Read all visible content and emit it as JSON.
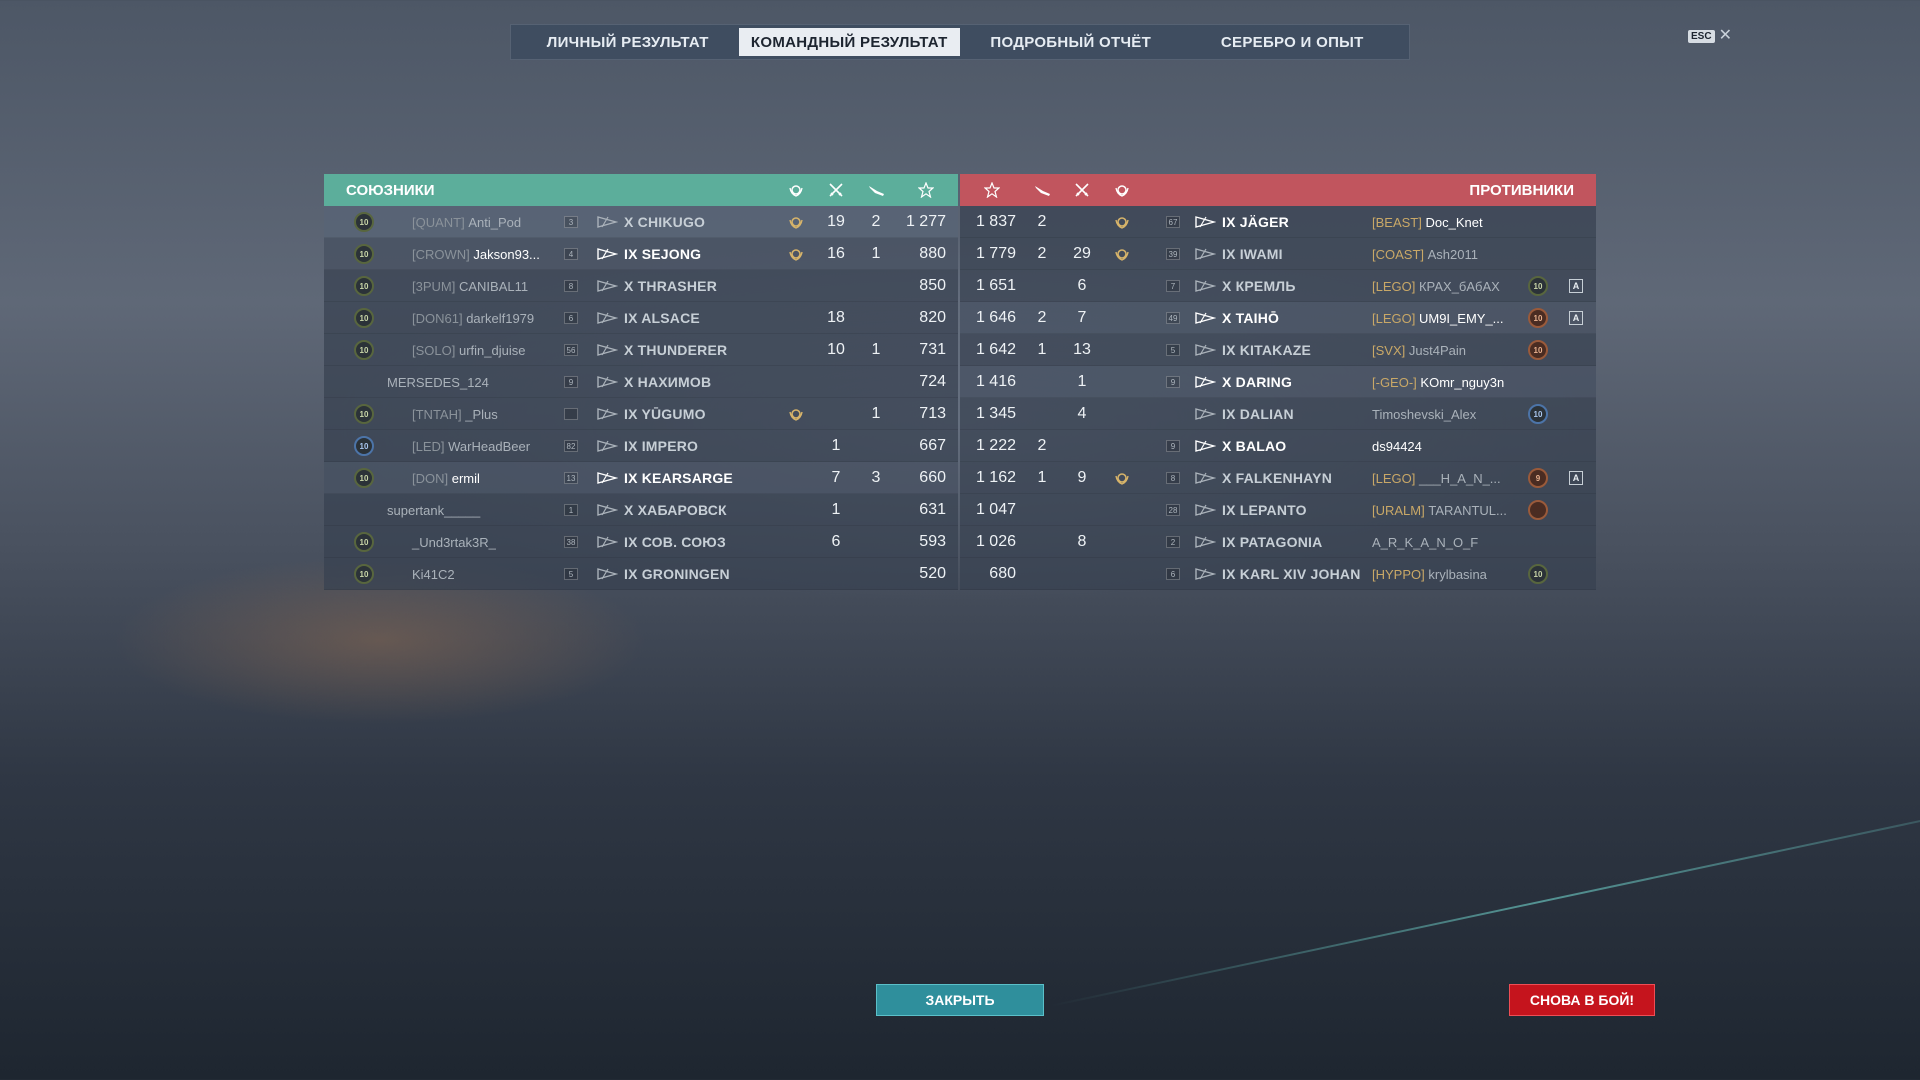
{
  "tabs": [
    {
      "label": "ЛИЧНЫЙ РЕЗУЛЬТАТ",
      "active": false
    },
    {
      "label": "КОМАНДНЫЙ РЕЗУЛЬТАТ",
      "active": true
    },
    {
      "label": "ПОДРОБНЫЙ ОТЧЁТ",
      "active": false
    },
    {
      "label": "СЕРЕБРО И ОПЫТ",
      "active": false
    }
  ],
  "esc_label": "ESC",
  "allies": {
    "title": "СОЮЗНИКИ",
    "accent": "#5cae9b",
    "rows": [
      {
        "level": "10",
        "clan": "[QUANT]",
        "player": "Anti_Pod",
        "rank": "3",
        "ship": "X CHIKUGO",
        "medal": true,
        "kills": "19",
        "planes": "2",
        "xp": "1 277",
        "highlight": "hl"
      },
      {
        "level": "10",
        "clan": "[CROWN]",
        "player": "Jakson93...",
        "rank": "4",
        "ship": "IX SEJONG",
        "medal": true,
        "kills": "16",
        "planes": "1",
        "xp": "880",
        "highlight": "hl2",
        "bright": true
      },
      {
        "level": "10",
        "clan": "[3PUM]",
        "player": "CANIBAL11",
        "rank": "8",
        "ship": "X THRASHER",
        "medal": false,
        "kills": "",
        "planes": "",
        "xp": "850",
        "highlight": ""
      },
      {
        "level": "10",
        "clan": "[DON61]",
        "player": "darkelf1979",
        "rank": "6",
        "ship": "IX ALSACE",
        "medal": false,
        "kills": "18",
        "planes": "",
        "xp": "820",
        "highlight": ""
      },
      {
        "level": "10",
        "clan": "[SOLO]",
        "player": "urfin_djuise",
        "rank": "56",
        "ship": "X THUNDERER",
        "medal": false,
        "kills": "10",
        "planes": "1",
        "xp": "731",
        "highlight": ""
      },
      {
        "level": "",
        "clan": "",
        "player": "MERSEDES_124",
        "rank": "9",
        "ship": "X НАХИМОВ",
        "medal": false,
        "kills": "",
        "planes": "",
        "xp": "724",
        "highlight": ""
      },
      {
        "level": "10",
        "clan": "[TNTAH]",
        "player": "_Plus",
        "rank": "",
        "ship": "IX YŪGUMO",
        "medal": true,
        "kills": "",
        "planes": "1",
        "xp": "713",
        "highlight": ""
      },
      {
        "level": "10",
        "clan": "[LED]",
        "player": "WarHeadBeer",
        "rank": "82",
        "ship": "IX IMPERO",
        "medal": false,
        "kills": "1",
        "planes": "",
        "xp": "667",
        "highlight": "",
        "blue": true
      },
      {
        "level": "10",
        "clan": "[DON]",
        "player": "ermil",
        "rank": "13",
        "ship": "IX KEARSARGE",
        "medal": false,
        "kills": "7",
        "planes": "3",
        "xp": "660",
        "highlight": "hl2",
        "bright": true
      },
      {
        "level": "",
        "clan": "",
        "player": "supertank_____",
        "rank": "1",
        "ship": "X ХАБАРОВСК",
        "medal": false,
        "kills": "1",
        "planes": "",
        "xp": "631",
        "highlight": ""
      },
      {
        "level": "10",
        "clan": "",
        "player": "_Und3rtak3R_",
        "rank": "38",
        "ship": "IX СОВ. СОЮЗ",
        "medal": false,
        "kills": "6",
        "planes": "",
        "xp": "593",
        "highlight": ""
      },
      {
        "level": "10",
        "clan": "",
        "player": "Ki41C2",
        "rank": "5",
        "ship": "IX GRONINGEN",
        "medal": false,
        "kills": "",
        "planes": "",
        "xp": "520",
        "highlight": ""
      }
    ]
  },
  "enemies": {
    "title": "ПРОТИВНИКИ",
    "accent": "#c1555e",
    "rows": [
      {
        "xp": "1 837",
        "planes": "2",
        "kills": "",
        "medal": true,
        "rank": "67",
        "ship": "IX JÄGER",
        "clan": "[BEAST]",
        "player": "Doc_Knet",
        "level": "",
        "flag": "",
        "highlight": "",
        "bright": true
      },
      {
        "xp": "1 779",
        "planes": "2",
        "kills": "29",
        "medal": true,
        "rank": "39",
        "ship": "IX IWAMI",
        "clan": "[COAST]",
        "player": "Ash2011",
        "level": "",
        "flag": "",
        "highlight": ""
      },
      {
        "xp": "1 651",
        "planes": "",
        "kills": "6",
        "medal": false,
        "rank": "7",
        "ship": "X КРЕМЛЬ",
        "clan": "[LEGO]",
        "player": "КРАХ_бАбАХ",
        "level": "10",
        "flag": "A",
        "highlight": ""
      },
      {
        "xp": "1 646",
        "planes": "2",
        "kills": "7",
        "medal": false,
        "rank": "49",
        "ship": "X TAIHŌ",
        "clan": "[LEGO]",
        "player": "UM9I_EMY_...",
        "level": "10",
        "flag": "A",
        "highlight": "hl2",
        "bright": true,
        "bronze": true
      },
      {
        "xp": "1 642",
        "planes": "1",
        "kills": "13",
        "medal": false,
        "rank": "5",
        "ship": "IX KITAKAZE",
        "clan": "[SVX]",
        "player": "Just4Pain",
        "level": "10",
        "flag": "",
        "highlight": "",
        "bronze": true
      },
      {
        "xp": "1 416",
        "planes": "",
        "kills": "1",
        "medal": false,
        "rank": "9",
        "ship": "X DARING",
        "clan": "[-GEO-]",
        "player": "KOmr_nguy3n",
        "level": "",
        "flag": "",
        "highlight": "hl2",
        "bright": true
      },
      {
        "xp": "1 345",
        "planes": "",
        "kills": "4",
        "medal": false,
        "rank": "",
        "ship": "IX DALIAN",
        "clan": "",
        "player": "Timoshevski_Alex",
        "level": "10",
        "flag": "",
        "highlight": "",
        "blue": true
      },
      {
        "xp": "1 222",
        "planes": "2",
        "kills": "",
        "medal": false,
        "rank": "9",
        "ship": "X BALAO",
        "clan": "",
        "player": "ds94424",
        "level": "",
        "flag": "",
        "highlight": "",
        "bright": true
      },
      {
        "xp": "1 162",
        "planes": "1",
        "kills": "9",
        "medal": true,
        "rank": "8",
        "ship": "X FALKENHAYN",
        "clan": "[LEGO]",
        "player": "___H_A_N_...",
        "level": "9",
        "flag": "A",
        "highlight": "",
        "bronze": true
      },
      {
        "xp": "1 047",
        "planes": "",
        "kills": "",
        "medal": false,
        "rank": "28",
        "ship": "IX LEPANTO",
        "clan": "[URALM]",
        "player": "TARANTUL...",
        "level": "",
        "flag": "",
        "highlight": "",
        "bronze": true,
        "badgeOnly": true
      },
      {
        "xp": "1 026",
        "planes": "",
        "kills": "8",
        "medal": false,
        "rank": "2",
        "ship": "IX PATAGONIA",
        "clan": "",
        "player": "A_R_K_A_N_O_F",
        "level": "",
        "flag": "",
        "highlight": ""
      },
      {
        "xp": "680",
        "planes": "",
        "kills": "",
        "medal": false,
        "rank": "6",
        "ship": "IX KARL XIV JOHAN",
        "clan": "[HYPPO]",
        "player": "krylbasina",
        "level": "10",
        "flag": "",
        "highlight": ""
      }
    ]
  },
  "icons": {
    "medal": "laurel-medal-icon",
    "kills": "crossed-swords-icon",
    "planes": "plane-icon",
    "xp": "star-icon"
  },
  "buttons": {
    "close": "ЗАКРЫТЬ",
    "again": "СНОВА В БОЙ!"
  },
  "colors": {
    "close_btn": "#2f8f9c",
    "again_btn": "#c5141d",
    "medal": "#d7b46a"
  }
}
